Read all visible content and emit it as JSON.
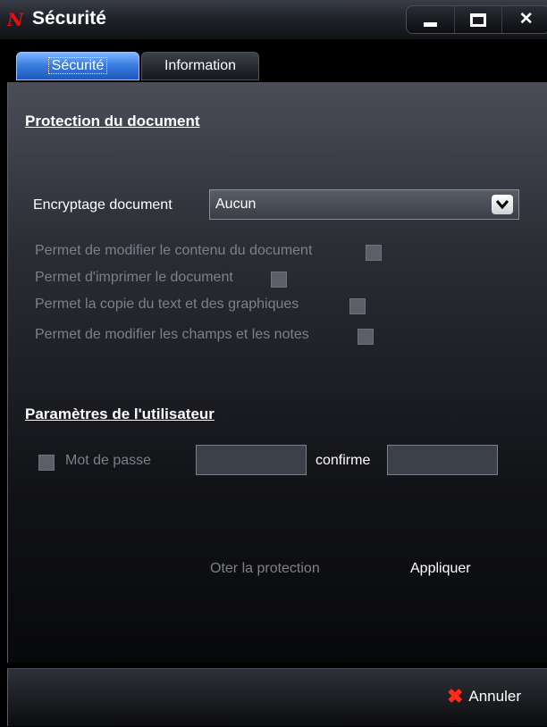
{
  "window": {
    "title": "Sécurité",
    "logo_letter": "N"
  },
  "tabs": [
    {
      "label": "Sécurité",
      "active": true
    },
    {
      "label": "Information",
      "active": false
    }
  ],
  "protection": {
    "section_title": "Protection du document",
    "encryption_label": "Encryptage document",
    "encryption_value": "Aucun",
    "permissions": [
      {
        "label": "Permet de modifier le contenu du document",
        "checked": false
      },
      {
        "label": "Permet d'imprimer le document",
        "checked": false
      },
      {
        "label": "Permet la copie du text et des graphiques",
        "checked": false
      },
      {
        "label": "Permet de modifier les champs et les notes",
        "checked": false
      }
    ]
  },
  "user": {
    "section_title": "Paramètres de l'utilisateur",
    "password_label": "Mot de passe",
    "password_value": "",
    "confirm_label": "confirme",
    "confirm_value": ""
  },
  "actions": {
    "remove_protection": "Oter la protection",
    "apply": "Appliquer",
    "cancel": "Annuler"
  },
  "colors": {
    "active_tab": "#3c7ee0",
    "logo": "#e21010",
    "cancel_icon": "#ff2a1a",
    "disabled_text": "#7d8088"
  }
}
